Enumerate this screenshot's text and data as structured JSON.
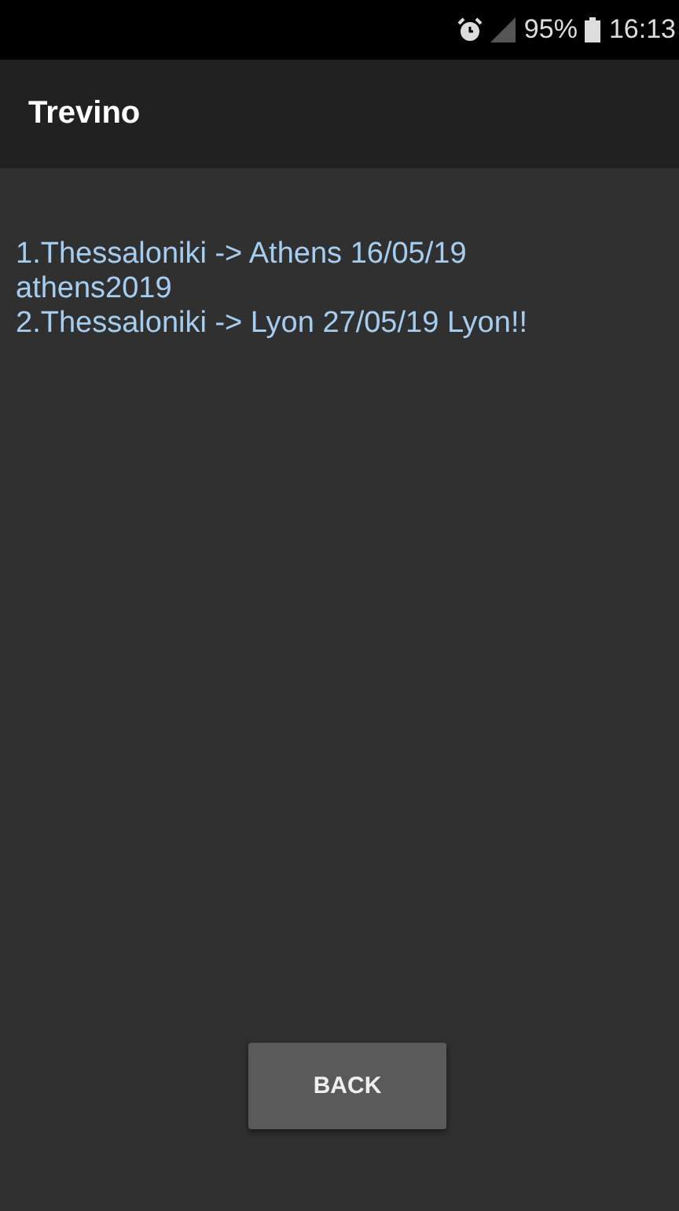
{
  "status_bar": {
    "battery": "95%",
    "time": "16:13"
  },
  "app_bar": {
    "title": "Trevino"
  },
  "lines": [
    "1.Thessaloniki -> Athens 16/05/19",
    "athens2019",
    "2.Thessaloniki -> Lyon 27/05/19 Lyon!!"
  ],
  "button": {
    "label": "BACK"
  }
}
